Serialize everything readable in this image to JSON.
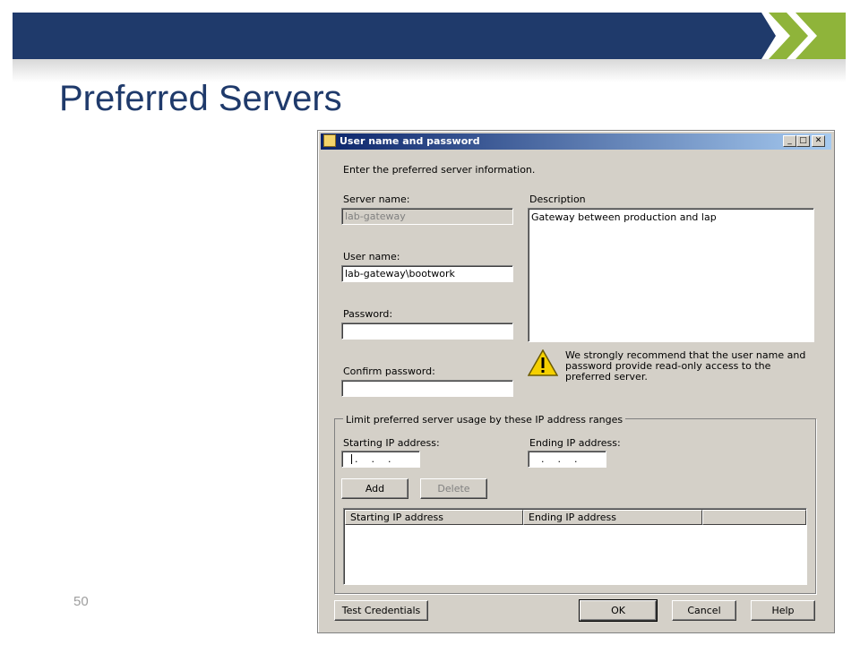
{
  "slide": {
    "title": "Preferred Servers",
    "page_number": "50",
    "colors": {
      "banner": "#1f3a6b",
      "chevron": "#8fb43a"
    }
  },
  "dialog": {
    "title": "User name and password",
    "controls": {
      "minimize": "_",
      "maximize": "□",
      "close": "✕"
    },
    "intro": "Enter the preferred server information.",
    "server_name": {
      "label": "Server name:",
      "value": "lab-gateway"
    },
    "user_name": {
      "label": "User name:",
      "value": "lab-gateway\\bootwork"
    },
    "password": {
      "label": "Password:",
      "value": ""
    },
    "confirm_password": {
      "label": "Confirm password:",
      "value": ""
    },
    "description": {
      "label": "Description",
      "value": "Gateway between production and lap"
    },
    "warning": {
      "icon": "warning-icon",
      "text": "We strongly recommend that the user name and password provide read-only access to the preferred server."
    },
    "ip_group": {
      "title": "Limit preferred server usage by these IP address ranges",
      "starting_label": "Starting IP address:",
      "ending_label": "Ending IP address:",
      "ip_placeholder_dots": "...",
      "add_button": "Add",
      "delete_button": "Delete",
      "columns": [
        "Starting IP address",
        "Ending IP address",
        ""
      ]
    },
    "buttons": {
      "test_credentials": "Test Credentials",
      "ok": "OK",
      "cancel": "Cancel",
      "help": "Help"
    }
  }
}
